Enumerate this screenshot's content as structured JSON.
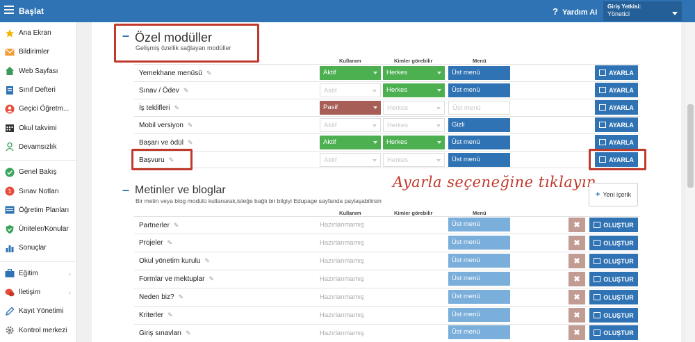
{
  "topbar": {
    "brand": "Başlat",
    "help": "Yardım AI",
    "role_title": "Giriş Yetkisi:",
    "role_value": "Yönetici"
  },
  "sidebar": {
    "items": [
      {
        "label": "Ana Ekran",
        "icon": "star-icon"
      },
      {
        "label": "Bildirimler",
        "icon": "envelope-icon"
      },
      {
        "label": "Web Sayfası",
        "icon": "home-icon"
      },
      {
        "label": "Sınıf Defteri",
        "icon": "book-icon"
      },
      {
        "label": "Geçici Öğretm...",
        "icon": "user-icon"
      },
      {
        "label": "Okul takvimi",
        "icon": "calendar-icon"
      },
      {
        "label": "Devamsızlık",
        "icon": "person-icon"
      },
      {
        "label": "Genel Bakış",
        "icon": "check-circle-icon"
      },
      {
        "label": "Sınav Notları",
        "icon": "grade-icon"
      },
      {
        "label": "Öğretim Planları",
        "icon": "plan-icon"
      },
      {
        "label": "Üniteler/Konular",
        "icon": "shield-check-icon"
      },
      {
        "label": "Sonuçlar",
        "icon": "bar-chart-icon"
      },
      {
        "label": "Eğitim",
        "icon": "briefcase-icon"
      },
      {
        "label": "İletişim",
        "icon": "chat-icon"
      },
      {
        "label": "Kayıt Yönetimi",
        "icon": "pen-icon"
      },
      {
        "label": "Kontrol merkezi",
        "icon": "gear-icon"
      }
    ]
  },
  "modules": {
    "title": "Özel modüller",
    "subtitle": "Gelişmiş özellik sağlayan modüller",
    "col_usage": "Kullanım",
    "col_visible": "Kimler görebilir",
    "col_menu": "Menü",
    "button_label": "AYARLA",
    "rows": [
      {
        "name": "Yemekhane menüsü",
        "usage": "Aktif",
        "visible": "Herkes",
        "menu": "Üst menü"
      },
      {
        "name": "Sınav / Ödev",
        "usage": "Aktif",
        "visible": "Herkes",
        "menu": "Üst menü"
      },
      {
        "name": "İş teklifleri",
        "usage": "Pasif",
        "visible": "Herkes",
        "menu": "Üst menü"
      },
      {
        "name": "Mobil versiyon",
        "usage": "Aktif",
        "visible": "Herkes",
        "menu": "Gizli"
      },
      {
        "name": "Başarı ve ödül",
        "usage": "Aktif",
        "visible": "Herkes",
        "menu": "Üst menü"
      },
      {
        "name": "Başvuru",
        "usage": "Aktif",
        "visible": "Herkes",
        "menu": "Üst menü"
      }
    ]
  },
  "blogs": {
    "title": "Metinler ve bloglar",
    "subtitle": "Bir metin veya blog modülü kullanarak,isteğe bağlı bir bilgiyi Edupage sayfanda paylaşabilirsin",
    "col_usage": "Kullanım",
    "col_visible": "Kimler görebilir",
    "col_menu": "Menü",
    "new_label": "Yeni içerik",
    "create_label": "OLUŞTUR",
    "delete_label": "✖",
    "rows": [
      {
        "name": "Partnerler",
        "status": "Hazırlanmamış",
        "menu": "Üst menü"
      },
      {
        "name": "Projeler",
        "status": "Hazırlanmamış",
        "menu": "Üst menü"
      },
      {
        "name": "Okul yönetim kurulu",
        "status": "Hazırlanmamış",
        "menu": "Üst menü"
      },
      {
        "name": "Formlar ve mektuplar",
        "status": "Hazırlanmamış",
        "menu": "Üst menü"
      },
      {
        "name": "Neden biz?",
        "status": "Hazırlanmamış",
        "menu": "Üst menü"
      },
      {
        "name": "Kriterler",
        "status": "Hazırlanmamış",
        "menu": "Üst menü"
      },
      {
        "name": "Giriş sınavları",
        "status": "Hazırlanmamış",
        "menu": "Üst menü"
      }
    ]
  },
  "annotation": "Ayarla seçeneğine tıklayın",
  "colors": {
    "primary": "#2f73b4",
    "active": "#4caf50",
    "passive": "#a65e57",
    "highlight": "#c0392b"
  }
}
